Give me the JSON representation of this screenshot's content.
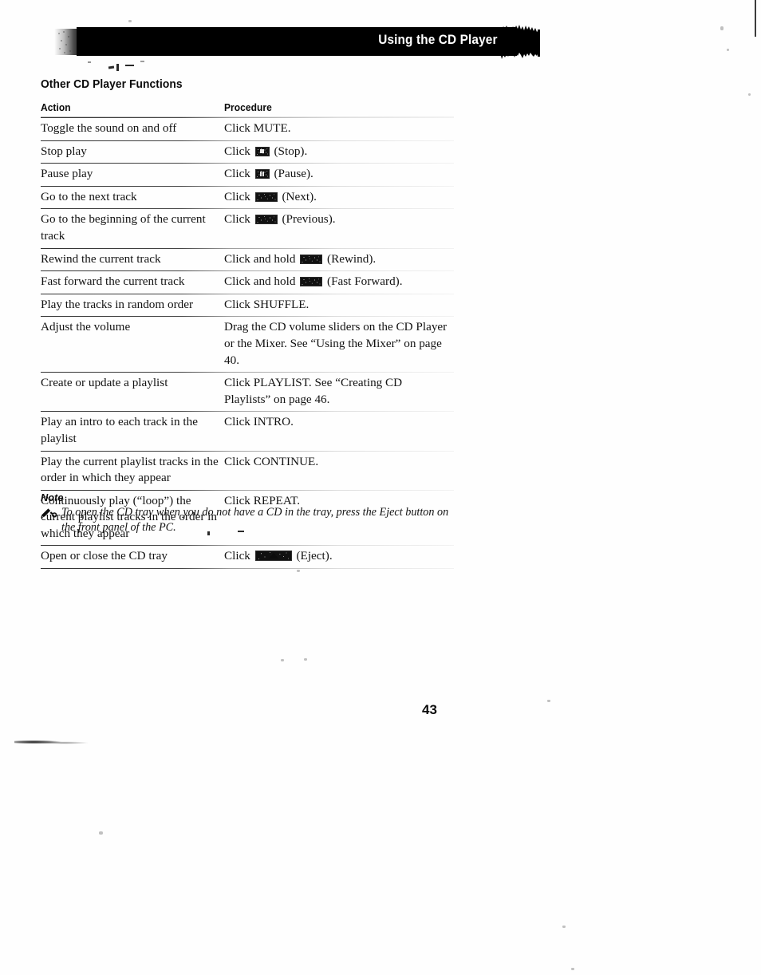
{
  "header": {
    "banner_title": "Using the CD Player"
  },
  "section": {
    "heading": "Other CD Player Functions"
  },
  "table": {
    "columns": [
      "Action",
      "Procedure"
    ],
    "rows": [
      {
        "action": "Toggle the sound on and off",
        "proc_pre": "Click MUTE.",
        "icon": null,
        "proc_post": ""
      },
      {
        "action": "Stop play",
        "proc_pre": "Click",
        "icon": "stop-button-icon",
        "proc_post": "(Stop)."
      },
      {
        "action": "Pause play",
        "proc_pre": "Click",
        "icon": "pause-button-icon",
        "proc_post": "(Pause)."
      },
      {
        "action": "Go to the next track",
        "proc_pre": "Click",
        "icon": "next-button-icon",
        "proc_post": "(Next)."
      },
      {
        "action": "Go to the beginning of the current track",
        "proc_pre": "Click",
        "icon": "previous-button-icon",
        "proc_post": "(Previous)."
      },
      {
        "action": "Rewind the current track",
        "proc_pre": "Click and hold",
        "icon": "rewind-button-icon",
        "proc_post": "(Rewind)."
      },
      {
        "action": "Fast forward the current track",
        "proc_pre": "Click and hold",
        "icon": "fast-forward-button-icon",
        "proc_post": "(Fast Forward)."
      },
      {
        "action": "Play the tracks in random order",
        "proc_pre": "Click SHUFFLE.",
        "icon": null,
        "proc_post": ""
      },
      {
        "action": "Adjust the volume",
        "proc_pre": "Drag the CD volume sliders on the CD Player or the Mixer. See “Using the Mixer” on page 40.",
        "icon": null,
        "proc_post": ""
      },
      {
        "action": "Create or update a playlist",
        "proc_pre": "Click PLAYLIST. See “Creating CD Playlists” on page 46.",
        "icon": null,
        "proc_post": ""
      },
      {
        "action": "Play an intro to each track in the playlist",
        "proc_pre": "Click INTRO.",
        "icon": null,
        "proc_post": ""
      },
      {
        "action": "Play the current playlist tracks in the order in which they appear",
        "proc_pre": "Click CONTINUE.",
        "icon": null,
        "proc_post": ""
      },
      {
        "action": "Continuously play (“loop”) the current playlist tracks in the order in which they appear",
        "proc_pre": "Click REPEAT.",
        "icon": null,
        "proc_post": ""
      },
      {
        "action": "Open or close the CD tray",
        "proc_pre": "Click",
        "icon": "eject-button-icon",
        "proc_post": "(Eject)."
      }
    ]
  },
  "note": {
    "label": "Note",
    "icon": "note-pencil-icon",
    "text": "To open the CD tray when you do not have a CD in the tray, press the Eject button on the front panel of the PC."
  },
  "footer": {
    "page_number": "43"
  }
}
